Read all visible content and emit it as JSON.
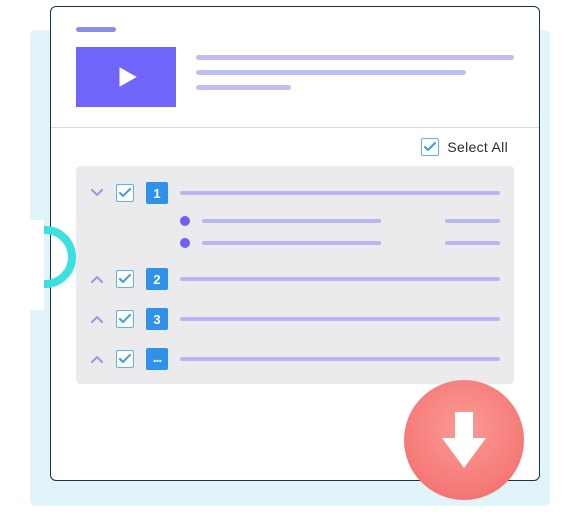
{
  "selectAll": {
    "label": "Select All",
    "checked": true
  },
  "items": [
    {
      "badge": "1",
      "expanded": true,
      "checked": true
    },
    {
      "badge": "2",
      "expanded": false,
      "checked": true
    },
    {
      "badge": "3",
      "expanded": false,
      "checked": true
    },
    {
      "badge": "...",
      "expanded": false,
      "checked": true
    }
  ],
  "colors": {
    "accent": "#7164F8",
    "badge": "#2F91E8",
    "download": "#F26968",
    "teal": "#3BE0E0"
  }
}
